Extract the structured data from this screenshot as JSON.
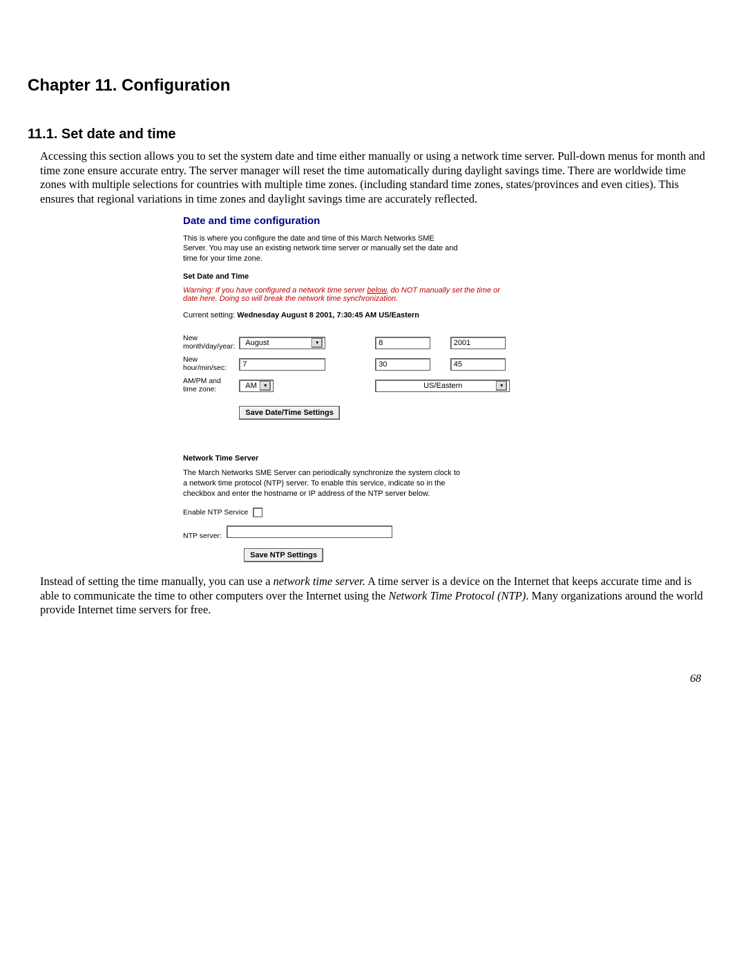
{
  "chapter_title": "Chapter 11. Configuration",
  "section_title": "11.1. Set date and time",
  "intro": "Accessing this section allows you to set the system date and time either manually or using a network time server. Pull-down menus for month and time zone ensure accurate entry. The server manager will reset the time automatically during daylight savings time. There are worldwide time zones with multiple selections for countries with multiple time zones. (including standard time zones, states/provinces and even cities). This ensures that regional variations in time zones and daylight savings time are accurately reflected.",
  "shot": {
    "title": "Date and time configuration",
    "para": "This is where you configure the date and time of this March Networks SME Server. You may use an existing network time server or manually set the date and time for your time zone.",
    "set_head": "Set Date and Time",
    "warn_pre": "Warning: If you have configured a network time server ",
    "warn_link": "below",
    "warn_post": ", do NOT manually set the time or date here. Doing so will break the network time synchronization.",
    "current_label": "Current setting: ",
    "current_value": "Wednesday August 8 2001, 7:30:45 AM US/Eastern",
    "row_date_label": "New month/day/year:",
    "row_time_label": "New hour/min/sec:",
    "row_tz_label": "AM/PM and time zone:",
    "month": "August",
    "day": "8",
    "year": "2001",
    "hour": "7",
    "min": "30",
    "sec": "45",
    "ampm": "AM",
    "tz": "US/Eastern",
    "save_dt": "Save Date/Time Settings",
    "ntp_head": "Network Time Server",
    "ntp_para": "The March Networks SME Server can periodically synchronize the system clock to a network time protocol (NTP) server. To enable this service, indicate so in the checkbox and enter the hostname or IP address of the NTP server below.",
    "ntp_enable": "Enable NTP Service",
    "ntp_server_label": "NTP server:",
    "ntp_server_value": "",
    "save_ntp": "Save NTP Settings"
  },
  "outro_1": "Instead of setting the time manually, you can use a ",
  "outro_em1": "network time server.",
  "outro_2": " A time server is a device on the Internet that keeps accurate time and is able to communicate the time to other computers over the Internet using the ",
  "outro_em2": "Network Time Protocol (NTP)",
  "outro_3": ". Many organizations around the world provide Internet time servers for free.",
  "page_number": "68"
}
